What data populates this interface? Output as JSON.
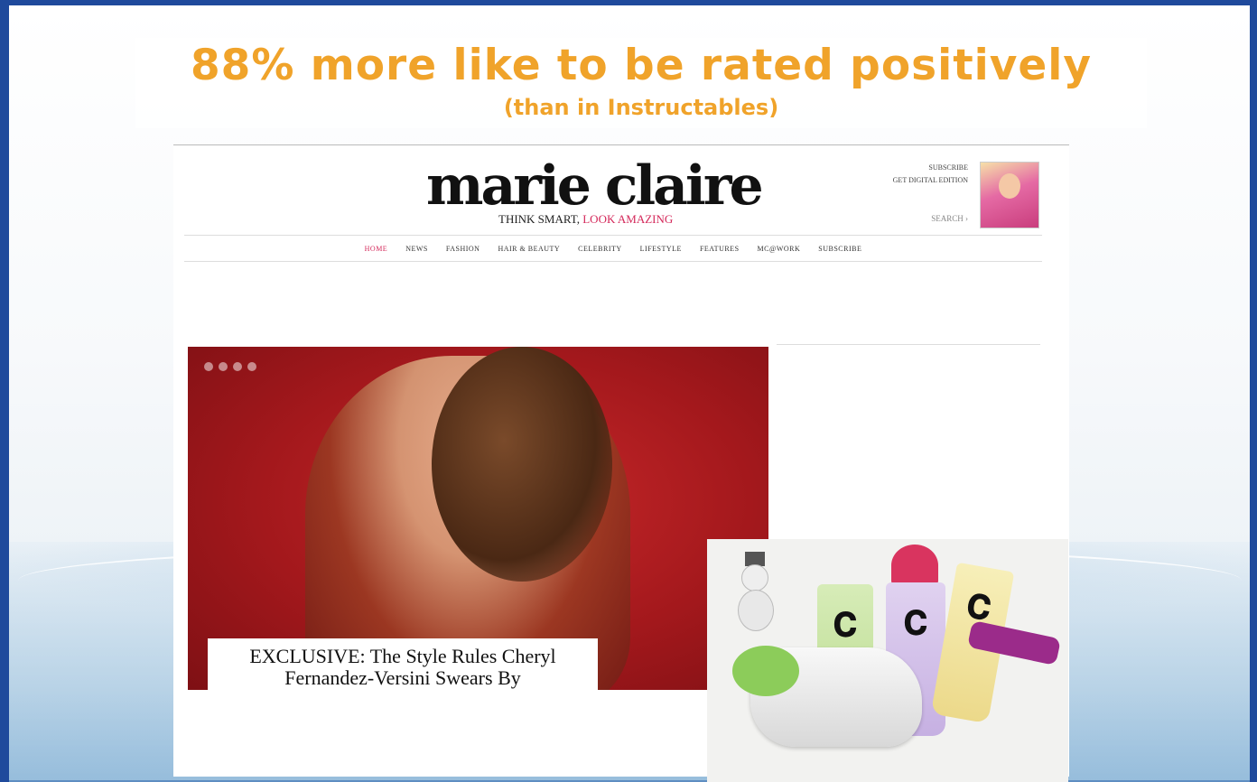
{
  "slide": {
    "headline": "88% more like to be rated positively",
    "subheadline": "(than in Instructables)"
  },
  "site": {
    "logo": "marie claire",
    "tagline_prefix": "THINK SMART, ",
    "tagline_highlight": "LOOK AMAZING",
    "sub_links": [
      "SUBSCRIBE",
      "GET DIGITAL EDITION"
    ],
    "search_label": "SEARCH",
    "nav": [
      {
        "label": "HOME",
        "active": true
      },
      {
        "label": "NEWS",
        "active": false
      },
      {
        "label": "FASHION",
        "active": false
      },
      {
        "label": "HAIR & BEAUTY",
        "active": false
      },
      {
        "label": "CELEBRITY",
        "active": false
      },
      {
        "label": "LIFESTYLE",
        "active": false
      },
      {
        "label": "FEATURES",
        "active": false
      },
      {
        "label": "MC@WORK",
        "active": false
      },
      {
        "label": "SUBSCRIBE",
        "active": false
      }
    ],
    "hero_caption_line1": "EXCLUSIVE: The Style Rules Cheryl",
    "hero_caption_line2": "Fernandez-Versini Swears By"
  },
  "colors": {
    "headline": "#f0a32a",
    "frame": "#1f4a9c",
    "accent": "#d4285a"
  }
}
